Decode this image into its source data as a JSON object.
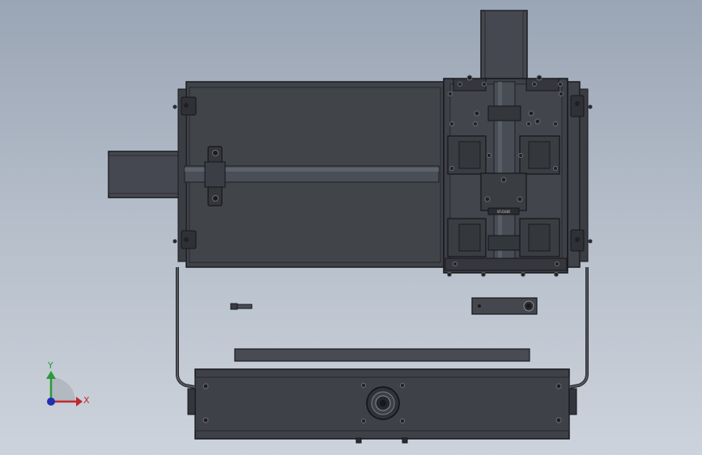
{
  "view": {
    "background_top": "#9aa5b5",
    "background_bottom": "#cdd3dc",
    "part_fill": "#3f4248",
    "part_edge": "#1a1b1f"
  },
  "triad": {
    "x_label": "X",
    "y_label": "Y",
    "x_color": "#c0282d",
    "y_color": "#2a9a3a",
    "z_color": "#2030b0"
  },
  "parts": {
    "nameplate_text": "SFU1605",
    "icons": [
      "bearing-block-icon",
      "ball-screw-icon",
      "linear-block-icon",
      "bolt-icon"
    ]
  }
}
